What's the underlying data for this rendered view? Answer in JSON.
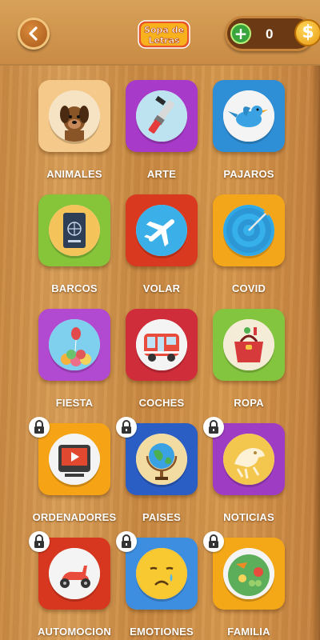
{
  "header": {
    "back_icon": "chevron-left-icon",
    "logo_line1": "Sopa de",
    "logo_line2": "Letras",
    "coin_count": "0",
    "add_icon": "plus-icon",
    "currency_icon": "dollar-coin-icon",
    "plus_symbol": "+",
    "dollar_symbol": "$"
  },
  "categories": [
    {
      "label": "ANIMALES",
      "icon": "dog-icon",
      "color": "#f5c98a",
      "locked": false
    },
    {
      "label": "ARTE",
      "icon": "paintbrush-icon",
      "color": "#a83ac9",
      "locked": false
    },
    {
      "label": "PAJAROS",
      "icon": "bird-icon",
      "color": "#2f8fd6",
      "locked": false
    },
    {
      "label": "BARCOS",
      "icon": "passport-icon",
      "color": "#86c43a",
      "locked": false
    },
    {
      "label": "VOLAR",
      "icon": "airplane-icon",
      "color": "#d9391e",
      "locked": false
    },
    {
      "label": "COVID",
      "icon": "target-icon",
      "color": "#f4a61a",
      "locked": false
    },
    {
      "label": "FIESTA",
      "icon": "balloons-icon",
      "color": "#b14ad1",
      "locked": false
    },
    {
      "label": "COCHES",
      "icon": "bus-icon",
      "color": "#cf2d3a",
      "locked": false
    },
    {
      "label": "ROPA",
      "icon": "handbag-icon",
      "color": "#84c540",
      "locked": false
    },
    {
      "label": "ORDENADORES",
      "icon": "video-player-icon",
      "color": "#f6a416",
      "locked": true
    },
    {
      "label": "PAISES",
      "icon": "globe-icon",
      "color": "#2b5ec4",
      "locked": true
    },
    {
      "label": "NOTICIAS",
      "icon": "dinosaur-icon",
      "color": "#9e3dc3",
      "locked": true
    },
    {
      "label": "AUTOMOCION",
      "icon": "scooter-icon",
      "color": "#d8371f",
      "locked": true
    },
    {
      "label": "EMOTIONES",
      "icon": "sad-face-icon",
      "color": "#3d8ee0",
      "locked": true
    },
    {
      "label": "FAMILIA",
      "icon": "food-plate-icon",
      "color": "#f5a817",
      "locked": true
    }
  ],
  "lock_icon": "lock-icon"
}
